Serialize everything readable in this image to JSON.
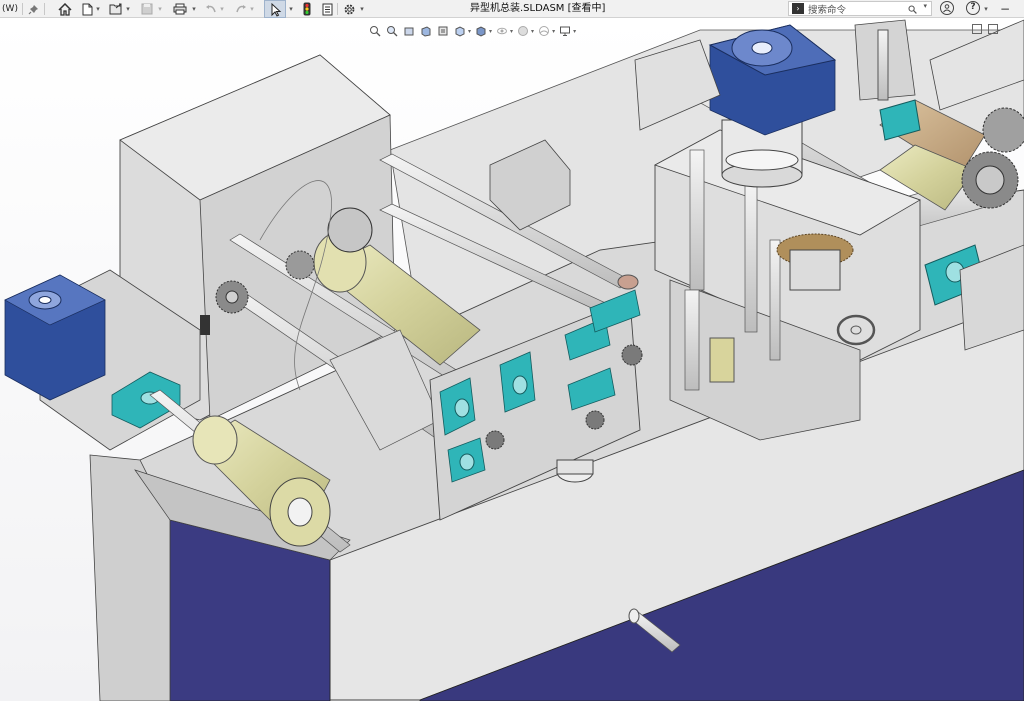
{
  "window": {
    "left_fragment": "(W)",
    "document_title": "异型机总装.SLDASM [查看中]"
  },
  "toolbar": {
    "items": [
      {
        "name": "pin-icon"
      },
      {
        "name": "home-icon"
      },
      {
        "name": "new-document-icon"
      },
      {
        "name": "open-icon"
      },
      {
        "name": "save-icon"
      },
      {
        "name": "print-icon"
      },
      {
        "name": "undo-icon"
      },
      {
        "name": "redo-icon"
      },
      {
        "name": "select-arrow-icon"
      },
      {
        "name": "traffic-light-icon"
      },
      {
        "name": "file-properties-icon"
      },
      {
        "name": "options-gear-icon"
      }
    ]
  },
  "search": {
    "placeholder": "搜索命令",
    "prompt_glyph": "›"
  },
  "right_buttons": {
    "user": "",
    "help": "?",
    "minimize": "−"
  },
  "view_toolbar": {
    "items": [
      "zoom-to-fit-icon",
      "zoom-area-icon",
      "previous-view-icon",
      "section-view-icon",
      "dynamic-annotation-icon",
      "view-orientation-icon",
      "display-style-icon",
      "hide-show-items-icon",
      "edit-appearance-icon",
      "apply-scene-icon",
      "view-settings-icon"
    ]
  },
  "colors": {
    "chrome_bg": "#f1f1f1",
    "frame_grey": "#d6d6d6",
    "frame_dark": "#bdbdbd",
    "panel_blue": "#39397e",
    "gearbox_blue": "#2f4f9c",
    "bearing_teal": "#2fb5b8",
    "roller_khaki": "#d9d7a3",
    "roller_tan": "#c7aa80",
    "brass_gear": "#b08f5b"
  }
}
